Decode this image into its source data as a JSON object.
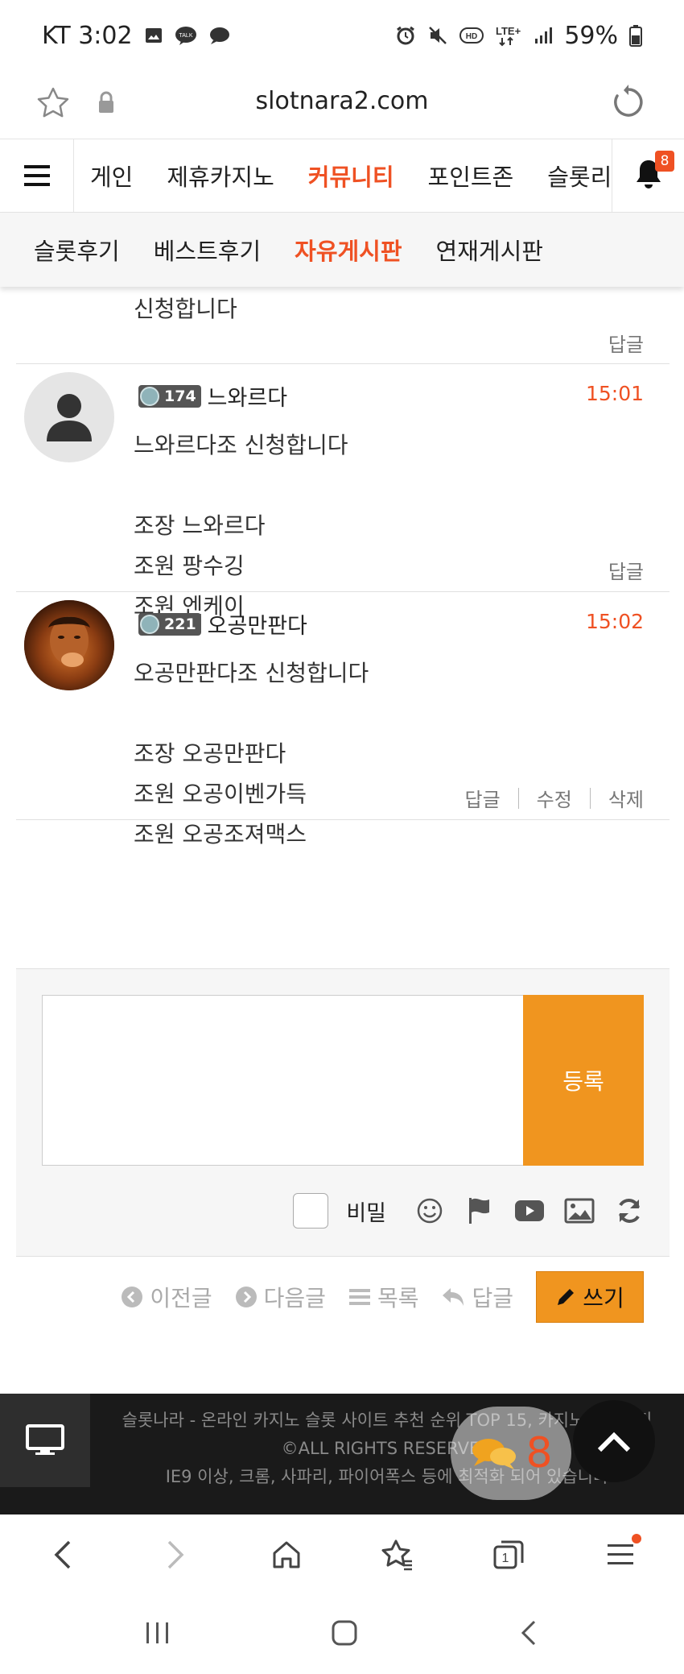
{
  "status_bar": {
    "carrier_time": "KT 3:02",
    "battery": "59%"
  },
  "address_bar": {
    "url": "slotnara2.com"
  },
  "main_nav": {
    "items": [
      {
        "label": "게인",
        "active": false
      },
      {
        "label": "제휴카지노",
        "active": false
      },
      {
        "label": "커뮤니티",
        "active": true
      },
      {
        "label": "포인트존",
        "active": false
      },
      {
        "label": "슬롯리",
        "active": false
      }
    ],
    "notification_count": "8"
  },
  "sub_nav": {
    "items": [
      {
        "label": "슬롯후기",
        "active": false
      },
      {
        "label": "베스트후기",
        "active": false
      },
      {
        "label": "자유게시판",
        "active": true
      },
      {
        "label": "연재게시판",
        "active": false
      }
    ]
  },
  "comments": {
    "previous_tail": {
      "text": "신청합니다",
      "reply": "답글"
    },
    "items": [
      {
        "level": "174",
        "author": "느와르다",
        "time": "15:01",
        "lines": [
          "느와르다조 신청합니다",
          "",
          "조장 느와르다",
          "조원 팡수깅",
          "조원 엔케이"
        ],
        "actions": [
          "답글"
        ]
      },
      {
        "level": "221",
        "author": "오공만판다",
        "time": "15:02",
        "lines": [
          "오공만판다조 신청합니다",
          "",
          "조장 오공만판다",
          "조원 오공이벤가득",
          "조원 오공조져맥스"
        ],
        "actions": [
          "답글",
          "수정",
          "삭제"
        ]
      }
    ]
  },
  "write_form": {
    "submit_label": "등록",
    "secret_label": "비밀"
  },
  "post_nav": {
    "prev": "이전글",
    "next": "다음글",
    "list": "목록",
    "reply": "답글",
    "write": "쓰기"
  },
  "footer": {
    "line1": "슬롯나라 - 온라인 카지노 슬롯 사이트 추천 순위 TOP 15, 카지노 커뮤니티",
    "line2": "©ALL RIGHTS RESERVED",
    "line3": "IE9 이상, 크롬, 사파리, 파이어폭스 등에 최적화 되어 있습니다",
    "chat_count": "8"
  },
  "colors": {
    "accent": "#ef5123",
    "button": "#f0951f",
    "footer_bg": "#1a1a1a"
  }
}
